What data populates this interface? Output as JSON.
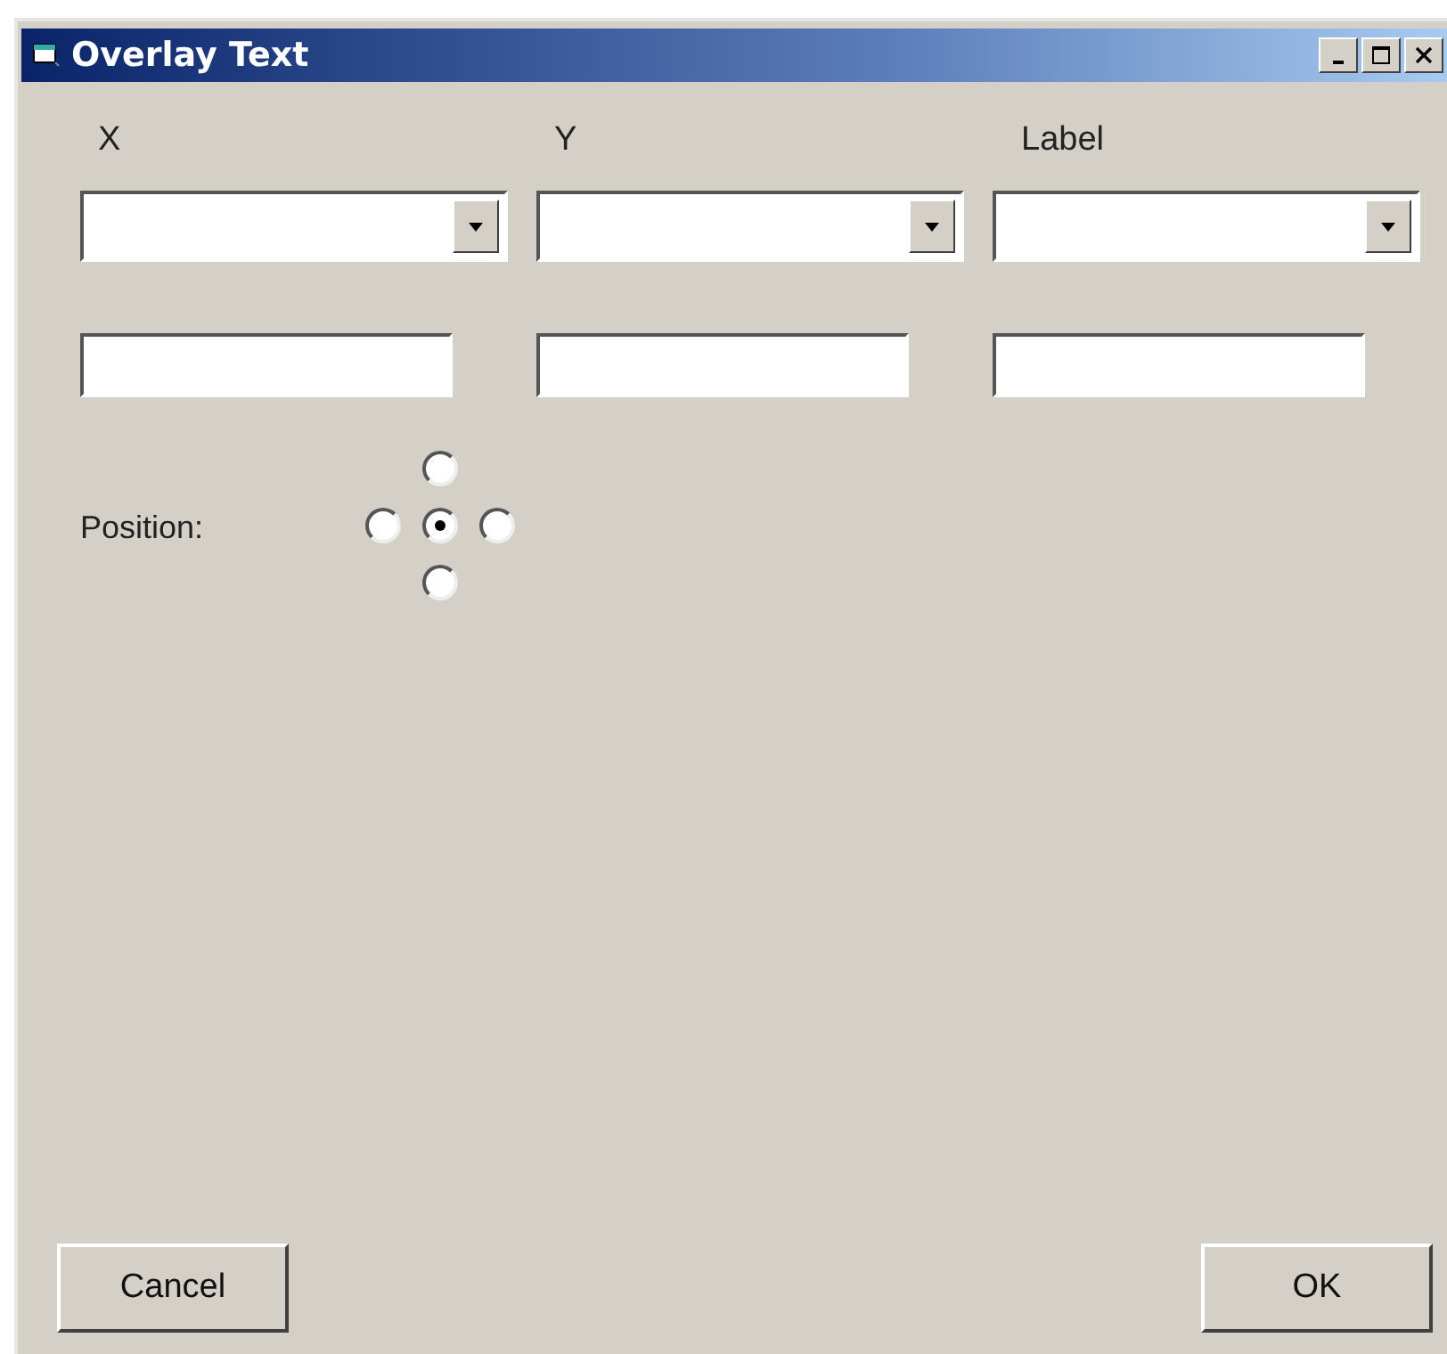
{
  "window": {
    "title": "Overlay Text"
  },
  "columns": [
    {
      "label": "X"
    },
    {
      "label": "Y"
    },
    {
      "label": "Label"
    }
  ],
  "position": {
    "label": "Position:",
    "options": [
      {
        "kind": "top",
        "selected": false
      },
      {
        "kind": "left",
        "selected": false
      },
      {
        "kind": "center",
        "selected": true
      },
      {
        "kind": "right",
        "selected": false
      },
      {
        "kind": "bottom",
        "selected": false
      }
    ]
  },
  "buttons": [
    {
      "label": "Cancel"
    },
    {
      "label": "OK"
    }
  ]
}
